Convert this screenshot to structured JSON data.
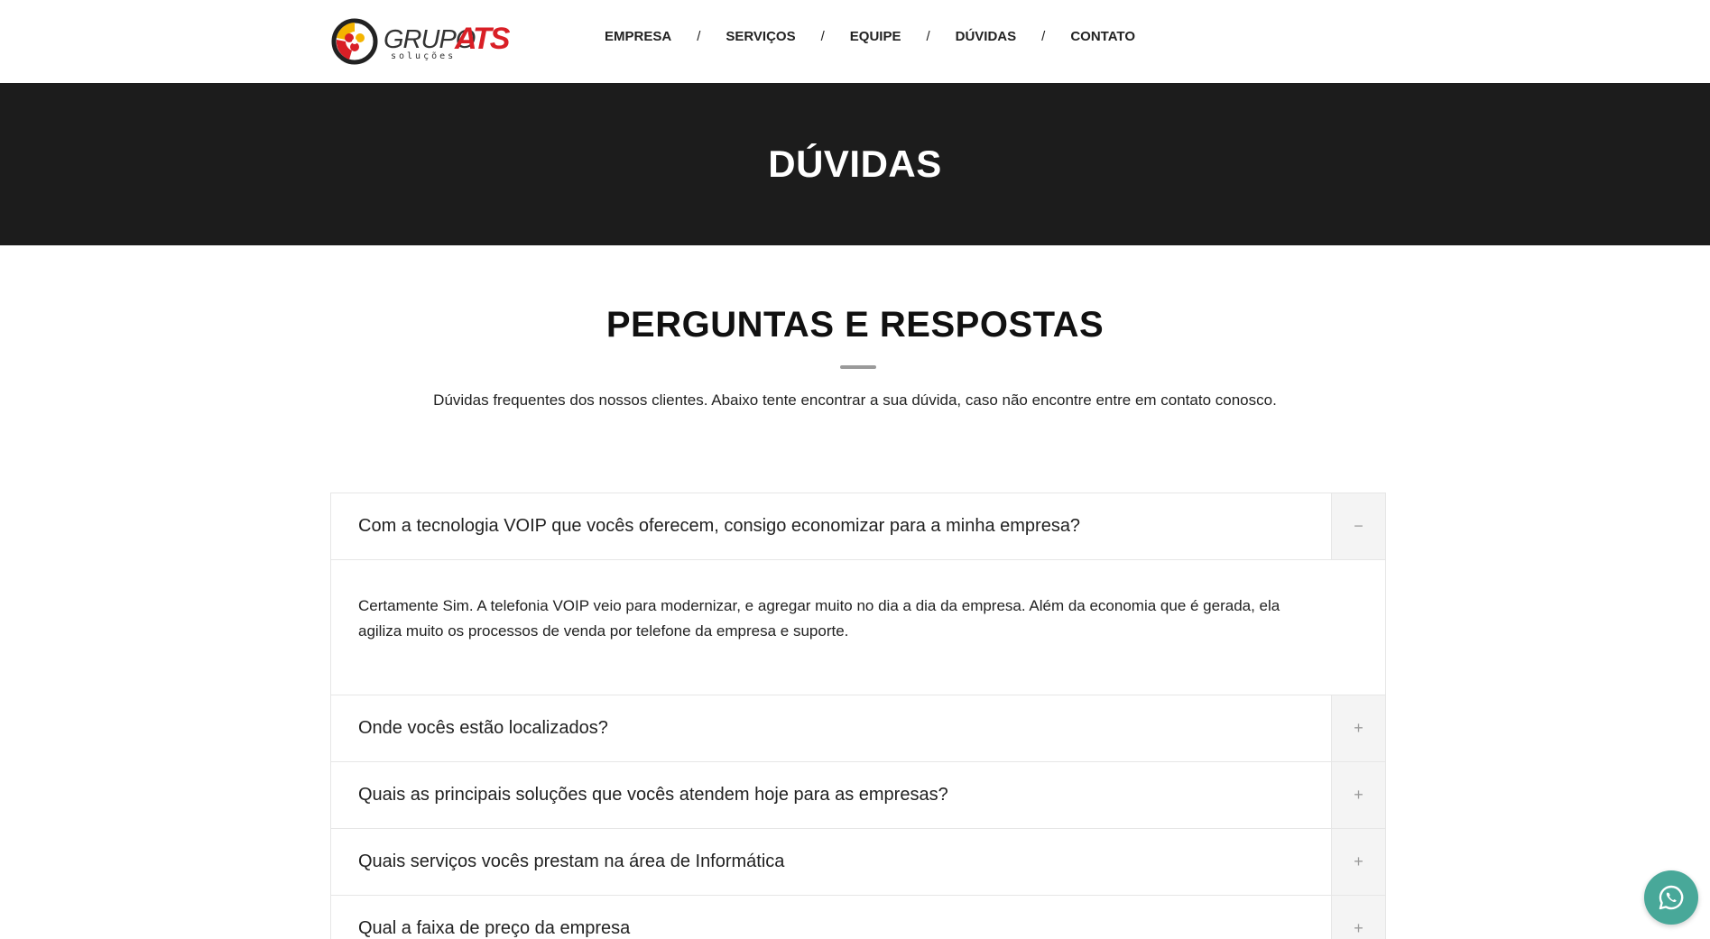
{
  "logo": {
    "brand": "GRUPO",
    "brand_accent": "ATS",
    "tagline": "soluções",
    "colors": {
      "accent": "#d91f26",
      "yellow": "#f4b400",
      "dark": "#333333"
    }
  },
  "nav": {
    "items": [
      {
        "label": "EMPRESA"
      },
      {
        "label": "SERVIÇOS"
      },
      {
        "label": "EQUIPE"
      },
      {
        "label": "DÚVIDAS"
      },
      {
        "label": "CONTATO"
      }
    ],
    "separator": "/"
  },
  "hero": {
    "title": "DÚVIDAS",
    "background": "#1c1c1c"
  },
  "section": {
    "title": "PERGUNTAS E RESPOSTAS",
    "subtitle": "Dúvidas frequentes dos nossos clientes. Abaixo tente encontrar a sua dúvida, caso não encontre entre em contato conosco."
  },
  "faq": [
    {
      "question": "Com a tecnologia VOIP que vocês oferecem, consigo economizar para a minha empresa?",
      "answer": "Certamente Sim. A telefonia VOIP veio para modernizar, e agregar muito no dia a dia da empresa. Além da economia que é gerada, ela agiliza muito os processos de venda por telefone da empresa e suporte.",
      "expanded": true,
      "toggle": "−"
    },
    {
      "question": "Onde vocês estão localizados?",
      "expanded": false,
      "toggle": "+"
    },
    {
      "question": "Quais as principais soluções que vocês atendem hoje para as empresas?",
      "expanded": false,
      "toggle": "+"
    },
    {
      "question": "Quais serviços vocês prestam na área de Informática",
      "expanded": false,
      "toggle": "+"
    },
    {
      "question": "Qual a faixa de preço da empresa",
      "expanded": false,
      "toggle": "+"
    }
  ],
  "whatsapp": {
    "icon": "whatsapp-icon",
    "color": "#48a899"
  }
}
